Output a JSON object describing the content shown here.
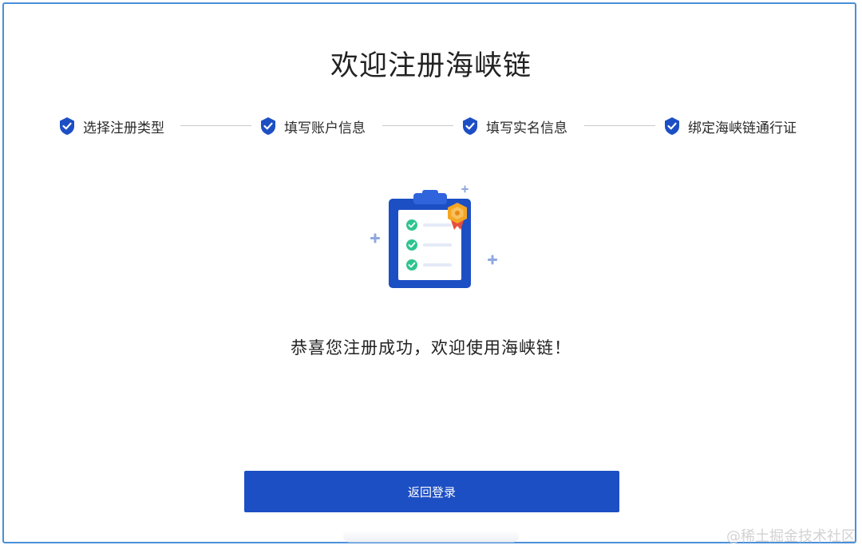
{
  "header": {
    "title": "欢迎注册海峡链"
  },
  "steps": [
    {
      "label": "选择注册类型",
      "status": "completed"
    },
    {
      "label": "填写账户信息",
      "status": "completed"
    },
    {
      "label": "填写实名信息",
      "status": "completed"
    },
    {
      "label": "绑定海峡链通行证",
      "status": "completed"
    }
  ],
  "main": {
    "success_message": "恭喜您注册成功，欢迎使用海峡链！",
    "illustration_icon": "clipboard-checklist-with-badge"
  },
  "actions": {
    "back_to_login_label": "返回登录"
  },
  "watermark": {
    "text": "@稀土掘金技术社区"
  },
  "colors": {
    "primary": "#1d4fc4",
    "border": "#4a90d9",
    "step_icon": "#1d4fc4",
    "check_green": "#2fc48f",
    "badge_orange": "#f5a623"
  }
}
